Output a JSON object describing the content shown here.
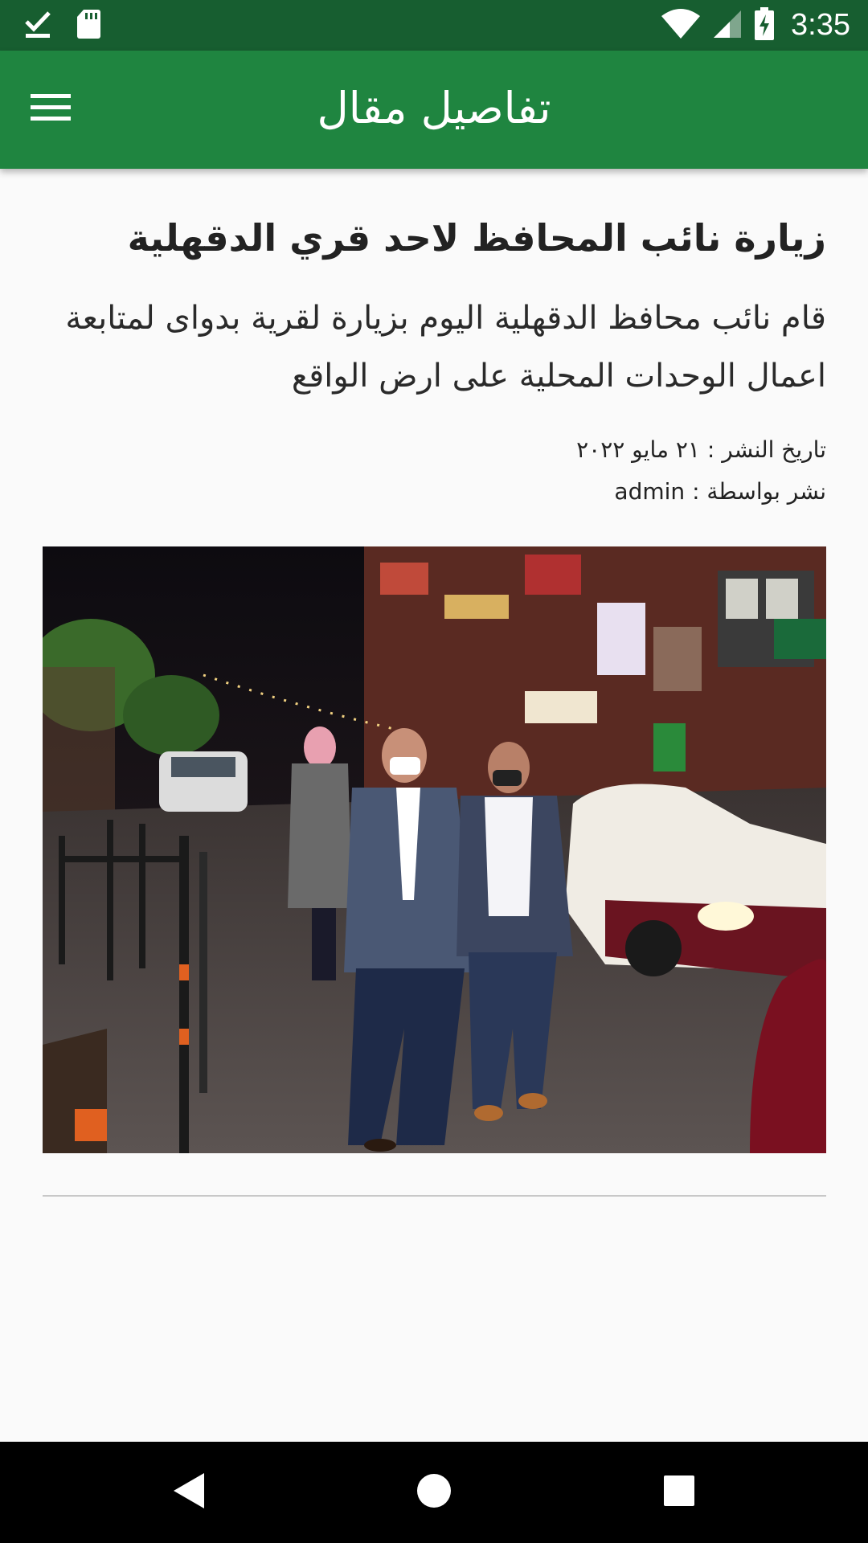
{
  "status_bar": {
    "time": "3:35",
    "icons": [
      "download-done-icon",
      "sd-card-icon",
      "wifi-icon",
      "cell-signal-icon",
      "battery-charging-icon"
    ]
  },
  "app_bar": {
    "title": "تفاصيل مقال",
    "menu_icon": "hamburger-menu-icon"
  },
  "article": {
    "title": "زيارة نائب المحافظ لاحد قري الدقهلية",
    "summary": "قام نائب محافظ الدقهلية اليوم بزيارة لقرية بدواى لمتابعة اعمال الوحدات المحلية على ارض الواقع",
    "publish_date_label": "تاريخ النشر :",
    "publish_date": "٢١ مايو ٢٠٢٢",
    "author_label": "نشر بواسطة :",
    "author": "admin",
    "image_icon": "article-photo"
  },
  "nav_bar": {
    "icons": [
      "back-icon",
      "home-icon",
      "recents-icon"
    ]
  },
  "colors": {
    "status_bar": "#175e30",
    "app_bar": "#1f8540",
    "background": "#fafafa"
  }
}
